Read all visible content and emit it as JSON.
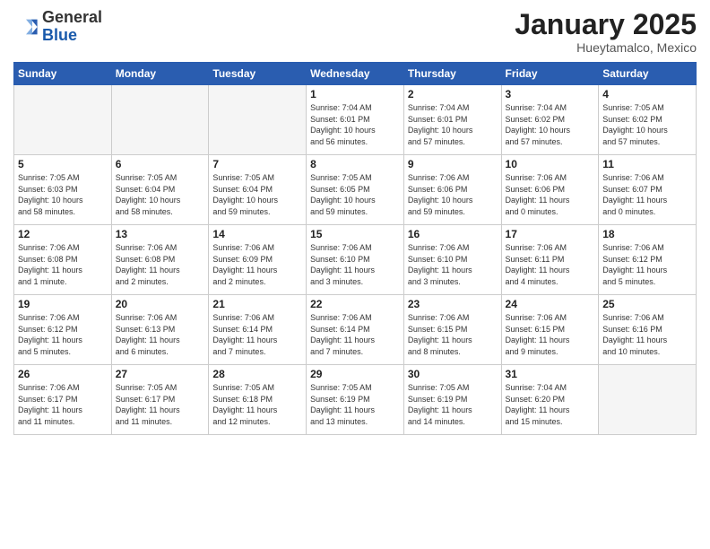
{
  "header": {
    "logo_general": "General",
    "logo_blue": "Blue",
    "month_title": "January 2025",
    "location": "Hueytamalco, Mexico"
  },
  "weekdays": [
    "Sunday",
    "Monday",
    "Tuesday",
    "Wednesday",
    "Thursday",
    "Friday",
    "Saturday"
  ],
  "weeks": [
    [
      {
        "day": "",
        "info": ""
      },
      {
        "day": "",
        "info": ""
      },
      {
        "day": "",
        "info": ""
      },
      {
        "day": "1",
        "info": "Sunrise: 7:04 AM\nSunset: 6:01 PM\nDaylight: 10 hours\nand 56 minutes."
      },
      {
        "day": "2",
        "info": "Sunrise: 7:04 AM\nSunset: 6:01 PM\nDaylight: 10 hours\nand 57 minutes."
      },
      {
        "day": "3",
        "info": "Sunrise: 7:04 AM\nSunset: 6:02 PM\nDaylight: 10 hours\nand 57 minutes."
      },
      {
        "day": "4",
        "info": "Sunrise: 7:05 AM\nSunset: 6:02 PM\nDaylight: 10 hours\nand 57 minutes."
      }
    ],
    [
      {
        "day": "5",
        "info": "Sunrise: 7:05 AM\nSunset: 6:03 PM\nDaylight: 10 hours\nand 58 minutes."
      },
      {
        "day": "6",
        "info": "Sunrise: 7:05 AM\nSunset: 6:04 PM\nDaylight: 10 hours\nand 58 minutes."
      },
      {
        "day": "7",
        "info": "Sunrise: 7:05 AM\nSunset: 6:04 PM\nDaylight: 10 hours\nand 59 minutes."
      },
      {
        "day": "8",
        "info": "Sunrise: 7:05 AM\nSunset: 6:05 PM\nDaylight: 10 hours\nand 59 minutes."
      },
      {
        "day": "9",
        "info": "Sunrise: 7:06 AM\nSunset: 6:06 PM\nDaylight: 10 hours\nand 59 minutes."
      },
      {
        "day": "10",
        "info": "Sunrise: 7:06 AM\nSunset: 6:06 PM\nDaylight: 11 hours\nand 0 minutes."
      },
      {
        "day": "11",
        "info": "Sunrise: 7:06 AM\nSunset: 6:07 PM\nDaylight: 11 hours\nand 0 minutes."
      }
    ],
    [
      {
        "day": "12",
        "info": "Sunrise: 7:06 AM\nSunset: 6:08 PM\nDaylight: 11 hours\nand 1 minute."
      },
      {
        "day": "13",
        "info": "Sunrise: 7:06 AM\nSunset: 6:08 PM\nDaylight: 11 hours\nand 2 minutes."
      },
      {
        "day": "14",
        "info": "Sunrise: 7:06 AM\nSunset: 6:09 PM\nDaylight: 11 hours\nand 2 minutes."
      },
      {
        "day": "15",
        "info": "Sunrise: 7:06 AM\nSunset: 6:10 PM\nDaylight: 11 hours\nand 3 minutes."
      },
      {
        "day": "16",
        "info": "Sunrise: 7:06 AM\nSunset: 6:10 PM\nDaylight: 11 hours\nand 3 minutes."
      },
      {
        "day": "17",
        "info": "Sunrise: 7:06 AM\nSunset: 6:11 PM\nDaylight: 11 hours\nand 4 minutes."
      },
      {
        "day": "18",
        "info": "Sunrise: 7:06 AM\nSunset: 6:12 PM\nDaylight: 11 hours\nand 5 minutes."
      }
    ],
    [
      {
        "day": "19",
        "info": "Sunrise: 7:06 AM\nSunset: 6:12 PM\nDaylight: 11 hours\nand 5 minutes."
      },
      {
        "day": "20",
        "info": "Sunrise: 7:06 AM\nSunset: 6:13 PM\nDaylight: 11 hours\nand 6 minutes."
      },
      {
        "day": "21",
        "info": "Sunrise: 7:06 AM\nSunset: 6:14 PM\nDaylight: 11 hours\nand 7 minutes."
      },
      {
        "day": "22",
        "info": "Sunrise: 7:06 AM\nSunset: 6:14 PM\nDaylight: 11 hours\nand 7 minutes."
      },
      {
        "day": "23",
        "info": "Sunrise: 7:06 AM\nSunset: 6:15 PM\nDaylight: 11 hours\nand 8 minutes."
      },
      {
        "day": "24",
        "info": "Sunrise: 7:06 AM\nSunset: 6:15 PM\nDaylight: 11 hours\nand 9 minutes."
      },
      {
        "day": "25",
        "info": "Sunrise: 7:06 AM\nSunset: 6:16 PM\nDaylight: 11 hours\nand 10 minutes."
      }
    ],
    [
      {
        "day": "26",
        "info": "Sunrise: 7:06 AM\nSunset: 6:17 PM\nDaylight: 11 hours\nand 11 minutes."
      },
      {
        "day": "27",
        "info": "Sunrise: 7:05 AM\nSunset: 6:17 PM\nDaylight: 11 hours\nand 11 minutes."
      },
      {
        "day": "28",
        "info": "Sunrise: 7:05 AM\nSunset: 6:18 PM\nDaylight: 11 hours\nand 12 minutes."
      },
      {
        "day": "29",
        "info": "Sunrise: 7:05 AM\nSunset: 6:19 PM\nDaylight: 11 hours\nand 13 minutes."
      },
      {
        "day": "30",
        "info": "Sunrise: 7:05 AM\nSunset: 6:19 PM\nDaylight: 11 hours\nand 14 minutes."
      },
      {
        "day": "31",
        "info": "Sunrise: 7:04 AM\nSunset: 6:20 PM\nDaylight: 11 hours\nand 15 minutes."
      },
      {
        "day": "",
        "info": ""
      }
    ]
  ]
}
